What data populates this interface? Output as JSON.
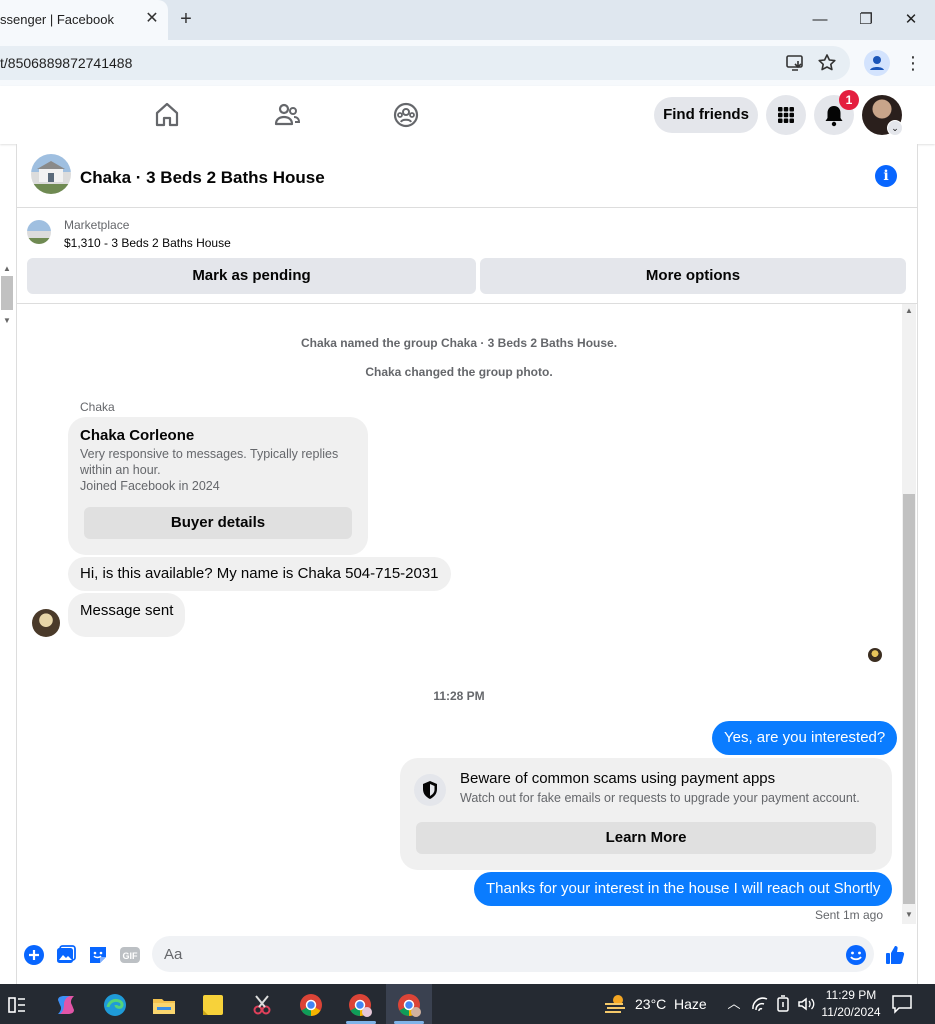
{
  "browser": {
    "tab_title": "ssenger | Facebook",
    "tab_close_glyph": "✕",
    "new_tab_glyph": "+",
    "minimize_glyph": "—",
    "maximize_glyph": "❐",
    "close_glyph": "✕",
    "url": "t/8506889872741488",
    "menu_glyph": "⋮"
  },
  "fb_nav": {
    "find_friends_label": "Find friends",
    "notification_count": "1",
    "account_chevron": "⌄"
  },
  "chat": {
    "title": "Chaka · 3 Beds 2 Baths House",
    "info_glyph": "i",
    "marketplace": {
      "label": "Marketplace",
      "listing": "$1,310 - 3 Beds 2 Baths House",
      "mark_pending_label": "Mark as pending",
      "more_options_label": "More options"
    },
    "system_messages": [
      "Chaka named the group Chaka · 3 Beds 2 Baths House.",
      "Chaka changed the group photo."
    ],
    "sender_name": "Chaka",
    "buyer_card": {
      "name": "Chaka Corleone",
      "line1": "Very responsive to messages. Typically replies",
      "line2": "within an hour.",
      "line3": "Joined Facebook in 2024",
      "button_label": "Buyer details"
    },
    "incoming": [
      "Hi, is this available? My name is Chaka 504-715-2031",
      "Message sent"
    ],
    "timestamp": "11:28 PM",
    "outgoing_1": "Yes, are you interested?",
    "scam_card": {
      "title": "Beware of common scams using payment apps",
      "subtitle": "Watch out for fake emails or requests to upgrade your payment account.",
      "button_label": "Learn More"
    },
    "outgoing_2": "Thanks for your interest in the house I will reach out Shortly",
    "sent_status": "Sent 1m ago",
    "composer_placeholder": "Aa"
  },
  "taskbar": {
    "temperature": "23°C",
    "weather": "Haze",
    "time": "11:29 PM",
    "date": "11/20/2024"
  },
  "colors": {
    "messenger_blue": "#0a7cff",
    "fb_blue": "#0866ff",
    "badge_red": "#e41e3f",
    "taskbar_bg": "#252a32"
  }
}
